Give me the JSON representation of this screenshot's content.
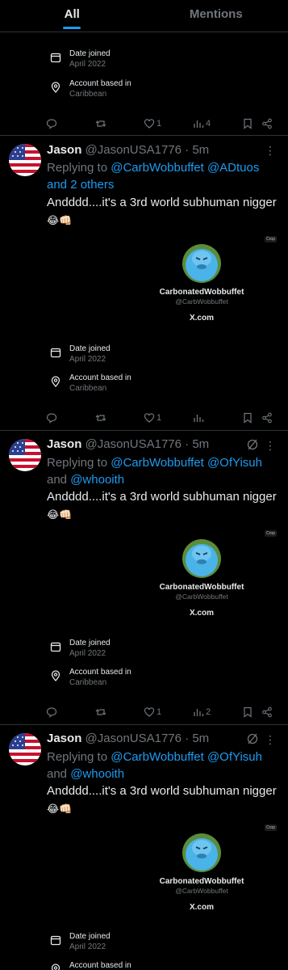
{
  "tabs": [
    {
      "label": "All",
      "active": true
    },
    {
      "label": "Mentions",
      "active": false
    }
  ],
  "about": {
    "date_label": "Date joined",
    "date_value": "April 2022",
    "based_label": "Account based in",
    "based_value": "Caribbean"
  },
  "embed": {
    "crop_label": "Crop",
    "name": "CarbonatedWobbuffet",
    "handle": "@CarbWobbuffet",
    "domain": "X.com"
  },
  "first_card_actions": {
    "likes": "1",
    "views": "4"
  },
  "tweets": [
    {
      "name": "Jason",
      "handle": "@JasonUSA1776 · 5m",
      "reply_prefix": "Replying to ",
      "reply_mentions": "@CarbWobbuffet @ADtuos",
      "reply_mid": "",
      "reply_tail": "and 2 others",
      "text": "Andddd....it's a 3rd world subhuman nigger",
      "emoji1": "😂",
      "emoji2": "👊🏻",
      "likes": "1",
      "views": ""
    },
    {
      "name": "Jason",
      "handle": "@JasonUSA1776 · 5m",
      "reply_prefix": "Replying to ",
      "reply_mentions": "@CarbWobbuffet @OfYisuh",
      "reply_mid": "and ",
      "reply_tail": "@whooith",
      "text": "Andddd....it's a 3rd world subhuman nigger",
      "emoji1": "😂",
      "emoji2": "👊🏻",
      "likes": "1",
      "views": "2"
    },
    {
      "name": "Jason",
      "handle": "@JasonUSA1776 · 5m",
      "reply_prefix": "Replying to ",
      "reply_mentions": "@CarbWobbuffet @OfYisuh",
      "reply_mid": "and ",
      "reply_tail": "@whooith",
      "text": "Andddd....it's a 3rd world subhuman nigger",
      "emoji1": "😂",
      "emoji2": "👊🏻",
      "likes": "",
      "views": ""
    }
  ]
}
